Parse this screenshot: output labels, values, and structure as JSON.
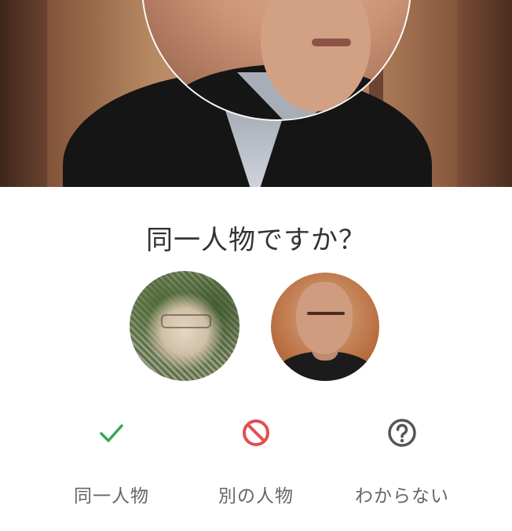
{
  "question": "同一人物ですか？",
  "images": {
    "header_photo": "man-in-black-kimono-photo",
    "candidate_a": "pixelated-face-avatar",
    "candidate_b": "bald-man-avatar"
  },
  "options": [
    {
      "label": "同一人物",
      "icon": "check-icon",
      "color": "#3aa655"
    },
    {
      "label": "別の人物",
      "icon": "prohibited-icon",
      "color": "#e05050"
    },
    {
      "label": "わからない",
      "icon": "question-circle-icon",
      "color": "#555555"
    }
  ]
}
